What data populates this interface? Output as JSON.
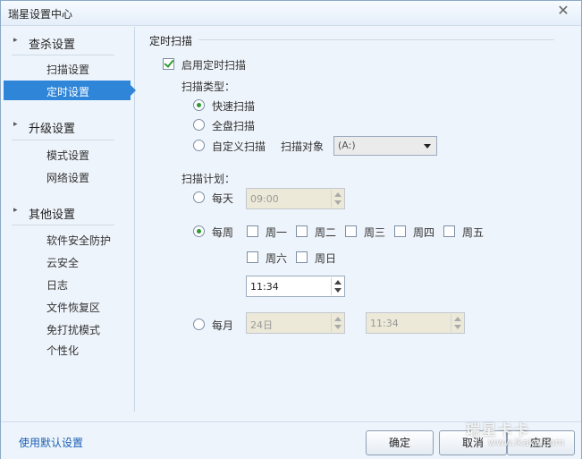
{
  "window": {
    "title": "瑞星设置中心",
    "close_glyph": "✕"
  },
  "sidebar": {
    "groups": [
      {
        "label": "查杀设置",
        "arrow": "▸",
        "items": [
          "扫描设置",
          "定时设置"
        ]
      },
      {
        "label": "升级设置",
        "arrow": "▸",
        "items": [
          "模式设置",
          "网络设置"
        ]
      },
      {
        "label": "其他设置",
        "arrow": "▸",
        "items": [
          "软件安全防护",
          "云安全",
          "日志",
          "文件恢复区",
          "免打扰模式",
          "个性化"
        ]
      }
    ],
    "active_item": "定时设置"
  },
  "main": {
    "section_title": "定时扫描",
    "enable_label": "启用定时扫描",
    "enable_checked": true,
    "scan_type_label": "扫描类型：",
    "scan_types": [
      "快速扫描",
      "全盘扫描",
      "自定义扫描"
    ],
    "scan_type_selected": "快速扫描",
    "scan_target_label": "扫描对象",
    "scan_target_value": "(A:)",
    "plan_label": "扫描计划：",
    "daily": {
      "label": "每天",
      "time": "09:00"
    },
    "weekly": {
      "label": "每周",
      "days": [
        "周一",
        "周二",
        "周三",
        "周四",
        "周五",
        "周六",
        "周日"
      ],
      "time": "11:34"
    },
    "monthly": {
      "label": "每月",
      "day": "24日",
      "time": "11:34"
    },
    "plan_selected": "每周"
  },
  "footer": {
    "default_link": "使用默认设置",
    "ok_label": "确定",
    "cancel_label": "取消",
    "apply_label": "应用"
  },
  "watermark": {
    "text": "瑞星卡卡",
    "sub": "www.ikaka.com"
  },
  "colors": {
    "accent": "#2f86d8",
    "check_green": "#2e9a35",
    "link": "#1a5fb4"
  }
}
